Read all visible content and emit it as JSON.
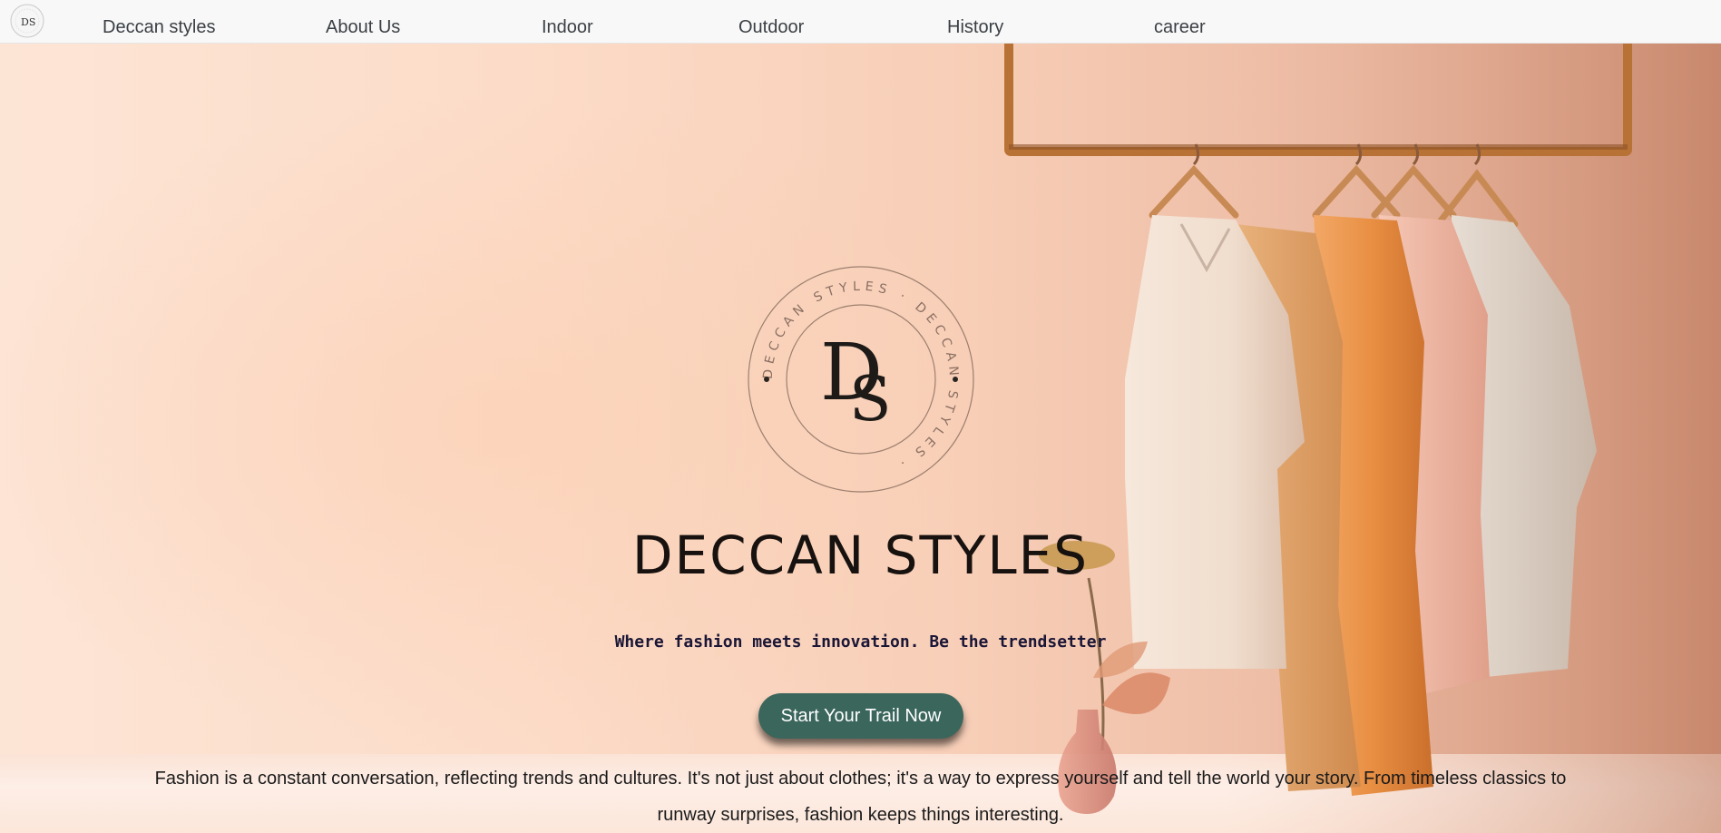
{
  "nav": {
    "logo_text": "DS",
    "links": [
      "Deccan styles",
      "About Us",
      "Indoor",
      "Outdoor",
      "History",
      "career"
    ]
  },
  "hero": {
    "emblem": {
      "monogram_d": "D",
      "monogram_s": "S",
      "ring_text": "DECCAN STYLES · DECCAN STYLES ·"
    },
    "title": "DECCAN STYLES",
    "tagline": "Where fashion meets innovation. Be the trendsetter",
    "cta_label": "Start Your Trail Now",
    "description": "Fashion is a constant conversation, reflecting trends and cultures. It's not just about clothes; it's a way to express yourself and tell the world your story. From timeless classics to runway surprises, fashion keeps things interesting."
  },
  "colors": {
    "nav_background": "#f8f8f8",
    "cta_background": "#3b665c",
    "hero_peach": "#fbd9c4"
  }
}
